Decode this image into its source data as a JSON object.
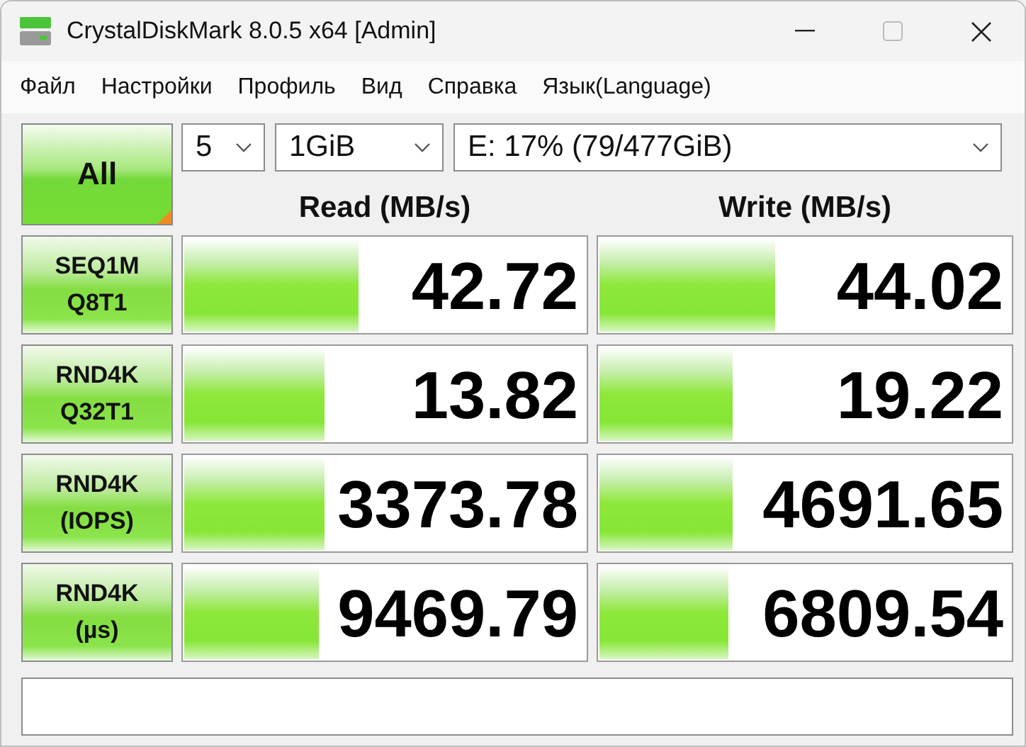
{
  "window": {
    "title": "CrystalDiskMark 8.0.5 x64 [Admin]"
  },
  "menu": [
    "Файл",
    "Настройки",
    "Профиль",
    "Вид",
    "Справка",
    "Язык(Language)"
  ],
  "all_button": "All",
  "count": "5",
  "size": "1GiB",
  "drive": "E: 17% (79/477GiB)",
  "headers": [
    "Read (MB/s)",
    "Write (MB/s)"
  ],
  "tests": [
    {
      "label": [
        "SEQ1M",
        "Q8T1"
      ],
      "read": {
        "value": "42.72",
        "level": 0.44
      },
      "write": {
        "value": "44.02",
        "level": 0.43
      }
    },
    {
      "label": [
        "RND4K",
        "Q32T1"
      ],
      "read": {
        "value": "13.82",
        "level": 0.355
      },
      "write": {
        "value": "19.22",
        "level": 0.33
      }
    },
    {
      "label": [
        "RND4K",
        "(IOPS)"
      ],
      "read": {
        "value": "3373.78",
        "level": 0.355
      },
      "write": {
        "value": "4691.65",
        "level": 0.33
      }
    },
    {
      "label": [
        "RND4K",
        "(µs)"
      ],
      "read": {
        "value": "9469.79",
        "level": 0.34
      },
      "write": {
        "value": "6809.54",
        "level": 0.32
      }
    }
  ]
}
